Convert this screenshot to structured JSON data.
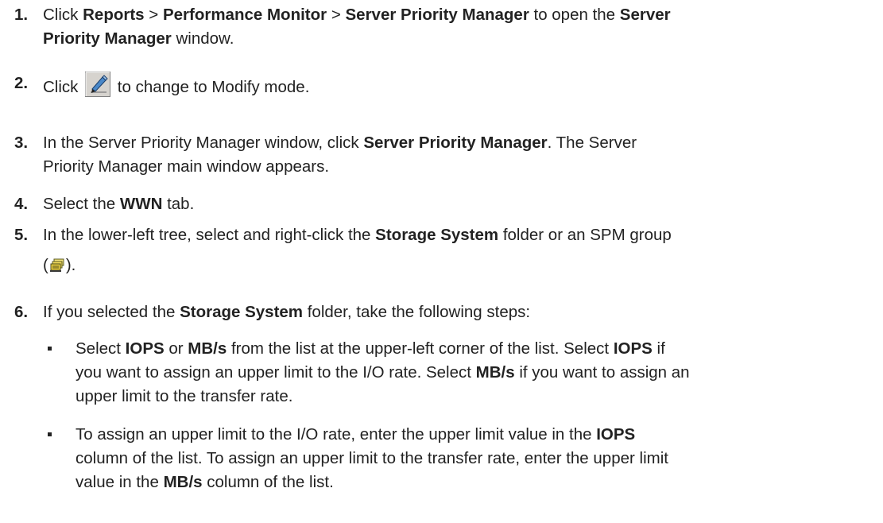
{
  "steps": [
    {
      "num": "1.",
      "parts": {
        "t1": "Click ",
        "b1": "Reports",
        "t2": " > ",
        "b2": "Performance Monitor",
        "t3": " > ",
        "b3": "Server Priority Manager",
        "t4": " to open the ",
        "b4": "Server",
        "b5": "Priority Manager",
        "t5": " window."
      }
    },
    {
      "num": "2.",
      "parts": {
        "t1": "Click ",
        "icon": "modify-mode-pen-icon",
        "t2": " to change to Modify mode."
      }
    },
    {
      "num": "3.",
      "parts": {
        "t1": "In the Server Priority Manager window, click ",
        "b1": "Server Priority Manager",
        "t2": ". The Server",
        "t3": "Priority Manager main window appears."
      }
    },
    {
      "num": "4.",
      "parts": {
        "t1": "Select the ",
        "b1": "WWN",
        "t2": " tab."
      }
    },
    {
      "num": "5.",
      "parts": {
        "t1": "In the lower-left tree, select and right-click the ",
        "b1": "Storage System",
        "t2": " folder or an SPM group",
        "t3": "(",
        "icon": "spm-group-icon",
        "t4": ")."
      }
    },
    {
      "num": "6.",
      "parts": {
        "t1": "If you selected the ",
        "b1": "Storage System",
        "t2": " folder, take the following steps:"
      }
    }
  ],
  "substeps": [
    {
      "l1a": "Select ",
      "l1b": "IOPS",
      "l1c": " or ",
      "l1d": "MB/s",
      "l1e": " from the list at the upper-left corner of the list. Select ",
      "l1f": "IOPS",
      "l1g": " if",
      "l2a": "you want to assign an upper limit to the I/O rate. Select ",
      "l2b": "MB/s",
      "l2c": " if you want to assign an",
      "l3": "upper limit to the transfer rate."
    },
    {
      "l1a": "To assign an upper limit to the I/O rate, enter the upper limit value in the ",
      "l1b": "IOPS",
      "l2": "column of the list. To assign an upper limit to the transfer rate, enter the upper limit",
      "l3a": "value in the ",
      "l3b": "MB/s",
      "l3c": " column of the list."
    }
  ]
}
